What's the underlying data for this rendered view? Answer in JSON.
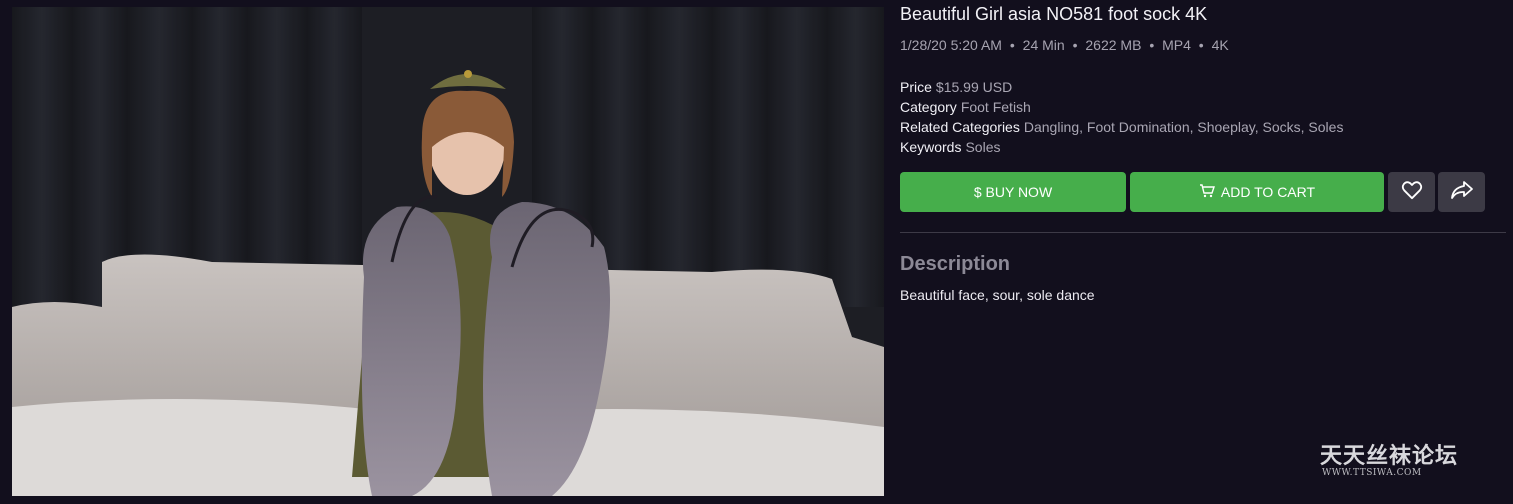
{
  "product": {
    "title": "Beautiful Girl asia NO581 foot sock 4K",
    "meta": {
      "date": "1/28/20 5:20 AM",
      "duration": "24 Min",
      "size": "2622 MB",
      "format": "MP4",
      "quality": "4K",
      "separator": "•"
    },
    "price": {
      "label": "Price",
      "value": "$15.99 USD"
    },
    "category": {
      "label": "Category",
      "value": "Foot Fetish"
    },
    "related": {
      "label": "Related Categories",
      "value": "Dangling, Foot Domination, Shoeplay, Socks, Soles"
    },
    "keywords": {
      "label": "Keywords",
      "value": "Soles"
    }
  },
  "actions": {
    "buy_label": "$ BUY NOW",
    "cart_label": "ADD TO CART",
    "favorite_icon": "heart-icon",
    "share_icon": "share-icon"
  },
  "description": {
    "heading": "Description",
    "text": "Beautiful face, sour, sole dance"
  },
  "watermark": {
    "text": "天天丝袜论坛",
    "url": "WWW.TTSIWA.COM"
  },
  "colors": {
    "background": "#120f1d",
    "accent_green": "#46ae4b",
    "icon_button": "#3c3a45",
    "muted_text": "#a9a6b3"
  }
}
